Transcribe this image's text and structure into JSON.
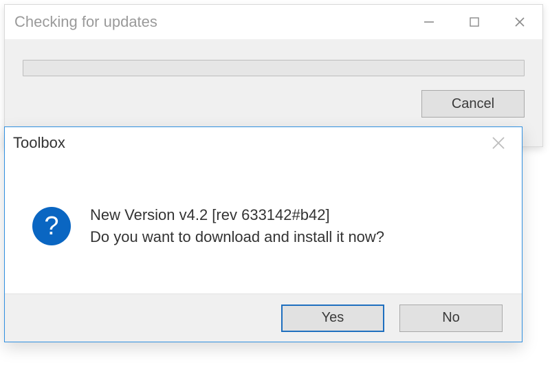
{
  "updateWindow": {
    "title": "Checking for updates",
    "cancel": "Cancel"
  },
  "dialog": {
    "title": "Toolbox",
    "line1": "New Version v4.2 [rev 633142#b42]",
    "line2": "Do you want to download and install it now?",
    "yes": "Yes",
    "no": "No"
  }
}
